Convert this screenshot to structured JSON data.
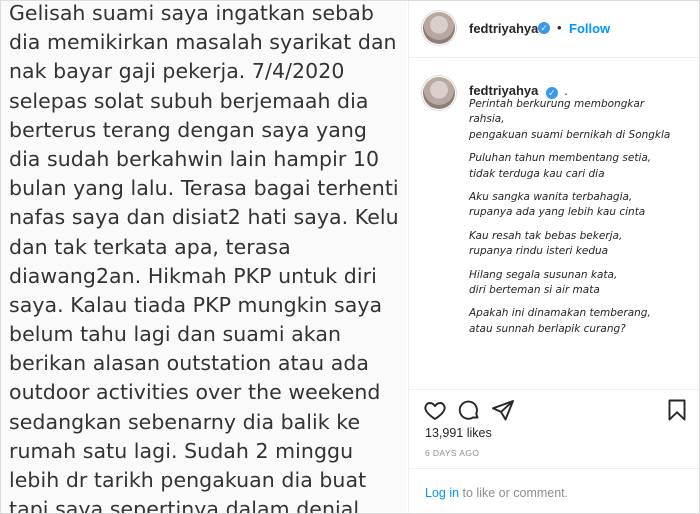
{
  "post_text_lines": [
    "Gelisah suami saya ingatkan sebab",
    "dia memikirkan masalah syarikat dan",
    "nak bayar gaji pekerja. 7/4/2020",
    "selepas solat subuh berjemaah dia",
    "berterus terang dengan saya yang",
    "dia sudah berkahwin lain hampir 10",
    "bulan yang lalu. Terasa bagai terhenti",
    "nafas saya dan disiat2 hati saya. Kelu",
    "dan tak terkata apa, terasa",
    "diawang2an. Hikmah PKP untuk diri",
    "saya. Kalau tiada PKP mungkin saya",
    "belum tahu lagi dan suami akan",
    "berikan alasan outstation atau ada",
    "outdoor activities over the weekend",
    "sedangkan sebenarny dia balik ke",
    "rumah satu lagi. Sudah 2 minggu",
    "lebih dr tarikh pengakuan dia buat",
    "tapi saya sepertinya dalam denial"
  ],
  "header": {
    "username": "fedtriyahya",
    "verified_glyph": "✓",
    "separator": "•",
    "follow_label": "Follow"
  },
  "caption": {
    "username": "fedtriyahya",
    "verified_glyph": "✓",
    "suffix": ".",
    "stanzas": [
      [
        "Perintah berkurung membongkar",
        "rahsia,",
        "pengakuan suami bernikah di Songkla"
      ],
      [
        "Puluhan tahun membentang setia,",
        "tidak terduga kau cari dia"
      ],
      [
        "Aku sangka wanita terbahagia,",
        "rupanya ada yang lebih kau cinta"
      ],
      [
        "Kau resah tak bebas bekerja,",
        "rupanya rindu isteri kedua"
      ],
      [
        "Hilang segala susunan kata,",
        "diri berteman si air mata"
      ],
      [
        "Apakah ini dinamakan temberang,",
        "atau sunnah berlapik curang?"
      ]
    ]
  },
  "icons": [
    "heart-icon",
    "comment-icon",
    "share-icon",
    "bookmark-icon"
  ],
  "likes_text": "13,991 likes",
  "time_ago": "6 DAYS AGO",
  "login": {
    "link": "Log in",
    "rest": " to like or comment."
  },
  "colors": {
    "accent": "#0095f6",
    "verified": "#3897f0",
    "muted": "#8e8e8e",
    "text": "#262626"
  }
}
